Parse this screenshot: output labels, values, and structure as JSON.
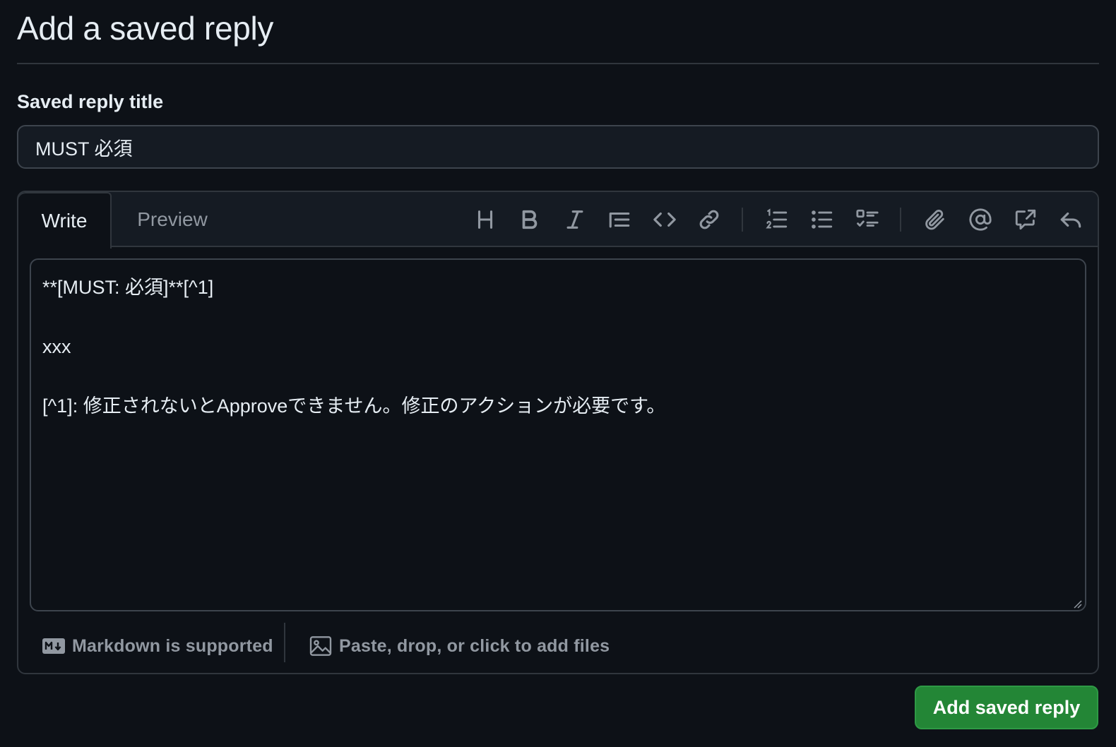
{
  "page": {
    "title": "Add a saved reply"
  },
  "form": {
    "title_label": "Saved reply title",
    "title_value": "MUST 必須"
  },
  "editor": {
    "tabs": [
      {
        "label": "Write",
        "active": true
      },
      {
        "label": "Preview",
        "active": false
      }
    ],
    "toolbar": [
      {
        "icon": "heading-icon",
        "label": "Heading"
      },
      {
        "icon": "bold-icon",
        "label": "Bold"
      },
      {
        "icon": "italic-icon",
        "label": "Italic"
      },
      {
        "icon": "quote-icon",
        "label": "Quote"
      },
      {
        "icon": "code-icon",
        "label": "Code"
      },
      {
        "icon": "link-icon",
        "label": "Link"
      },
      {
        "icon": "ordered-list-icon",
        "label": "Numbered list"
      },
      {
        "icon": "unordered-list-icon",
        "label": "Unordered list"
      },
      {
        "icon": "task-list-icon",
        "label": "Task list"
      },
      {
        "icon": "paperclip-icon",
        "label": "Attach files"
      },
      {
        "icon": "mention-icon",
        "label": "Mention"
      },
      {
        "icon": "cross-reference-icon",
        "label": "Reference"
      },
      {
        "icon": "reply-icon",
        "label": "Saved replies"
      }
    ],
    "body": "**[MUST: 必須]**[^1]\n\nxxx\n\n[^1]: 修正されないとApproveできません。修正のアクションが必要です。",
    "footer": {
      "markdown_label": "Markdown is supported",
      "files_label": "Paste, drop, or click to add files"
    }
  },
  "actions": {
    "submit_label": "Add saved reply",
    "submit_color": "#238636"
  },
  "colors": {
    "background": "#0d1117",
    "border": "#30363d",
    "text": "#e6edf3",
    "muted": "#9198a1"
  }
}
